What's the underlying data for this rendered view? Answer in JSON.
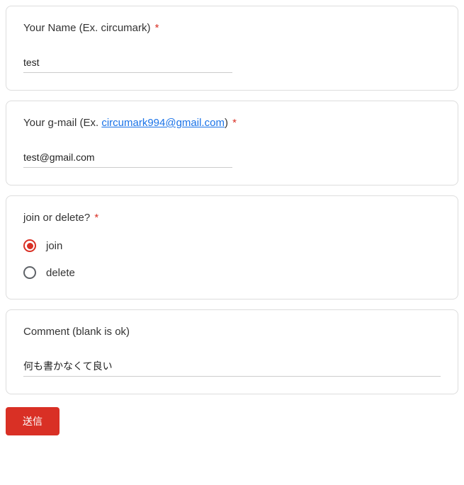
{
  "q1": {
    "label_prefix": "Your Name (Ex. circumark)",
    "required": "*",
    "value": "test"
  },
  "q2": {
    "label_prefix": "Your g-mail (Ex. ",
    "label_link": "circumark994@gmail.com",
    "label_suffix": ")",
    "required": "*",
    "value": "test@gmail.com"
  },
  "q3": {
    "label": "join or delete?",
    "required": "*",
    "options": {
      "opt0": "join",
      "opt1": "delete"
    },
    "selected": "opt0"
  },
  "q4": {
    "label": "Comment (blank is ok)",
    "value": "何も書かなくて良い"
  },
  "submit": {
    "label": "送信"
  }
}
